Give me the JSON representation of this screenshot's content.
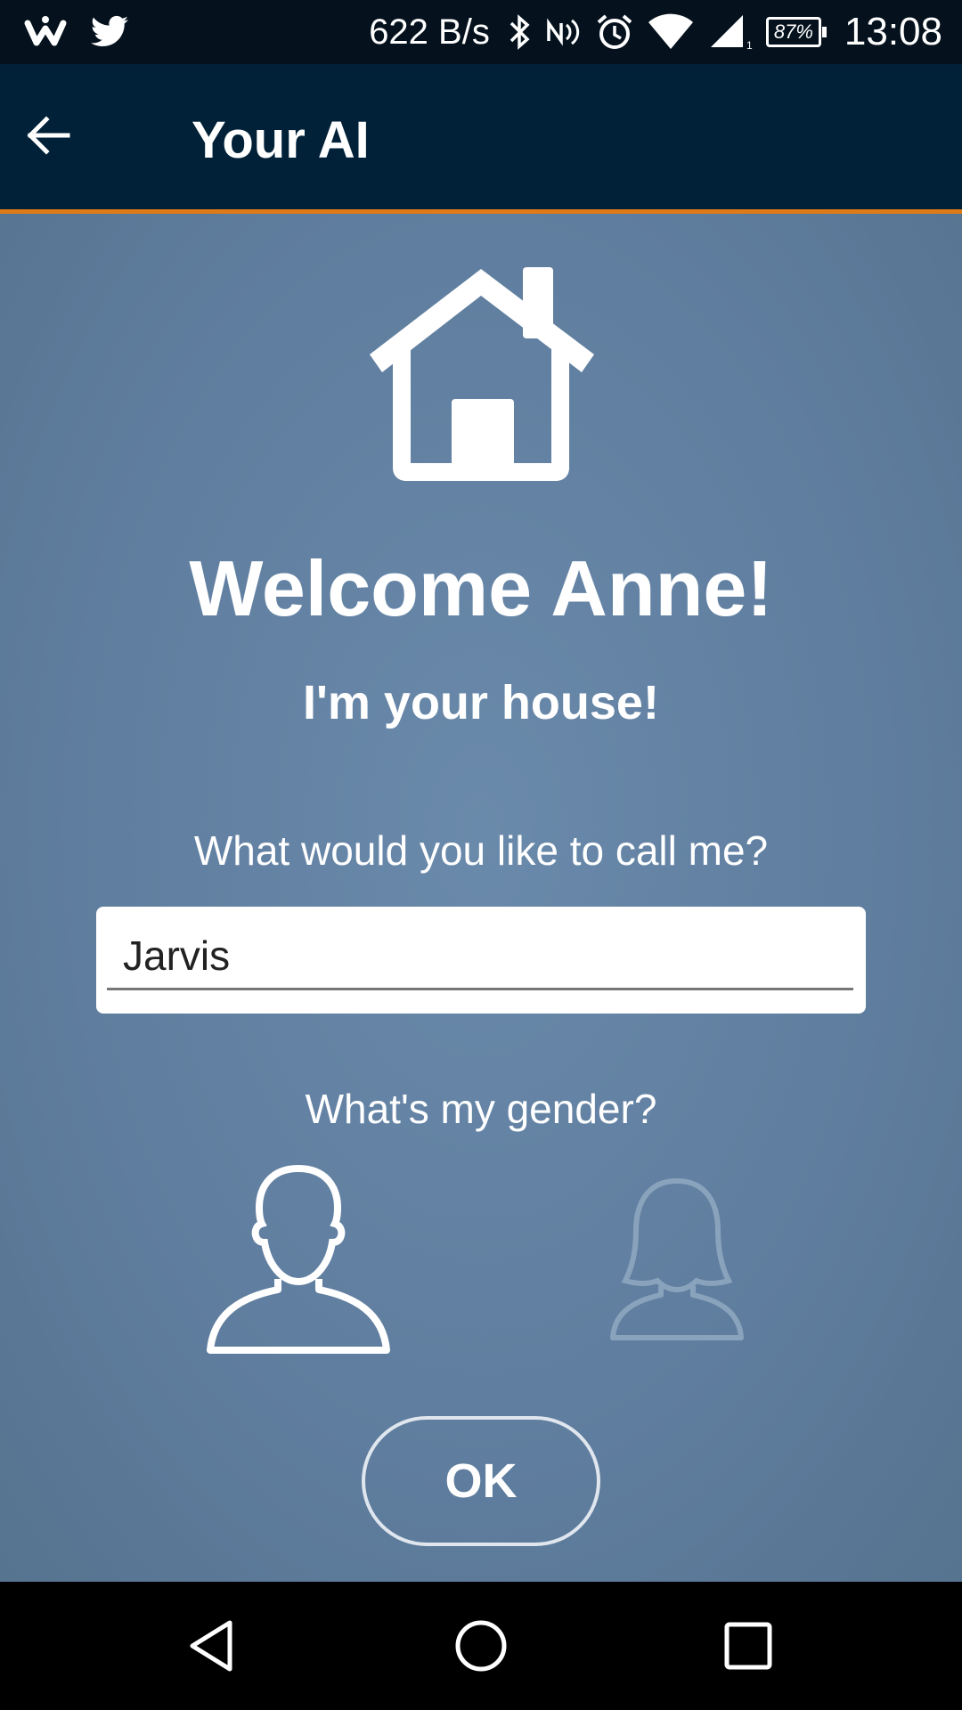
{
  "status_bar": {
    "speed": "622 B/s",
    "battery": "87%",
    "time": "13:08",
    "icons": [
      "w-app-icon",
      "twitter-icon",
      "bluetooth-icon",
      "nfc-icon",
      "alarm-icon",
      "wifi-icon",
      "signal-icon",
      "battery-icon"
    ]
  },
  "app_bar": {
    "title": "Your AI",
    "back_icon": "arrow-left-icon",
    "accent": "#e07a16",
    "background": "#012138"
  },
  "main": {
    "hero_icon": "house-icon",
    "welcome": "Welcome Anne!",
    "subtitle": "I'm your house!",
    "name_prompt": "What would you like to call me?",
    "name_value": "Jarvis",
    "gender_prompt": "What's my gender?",
    "gender_options": [
      {
        "icon": "male-avatar-icon",
        "selected": true
      },
      {
        "icon": "female-avatar-icon",
        "selected": false
      }
    ],
    "ok_label": "OK",
    "background": "#6080a2"
  },
  "nav_bar": {
    "icons": [
      "back-triangle-icon",
      "home-circle-icon",
      "recents-square-icon"
    ]
  }
}
